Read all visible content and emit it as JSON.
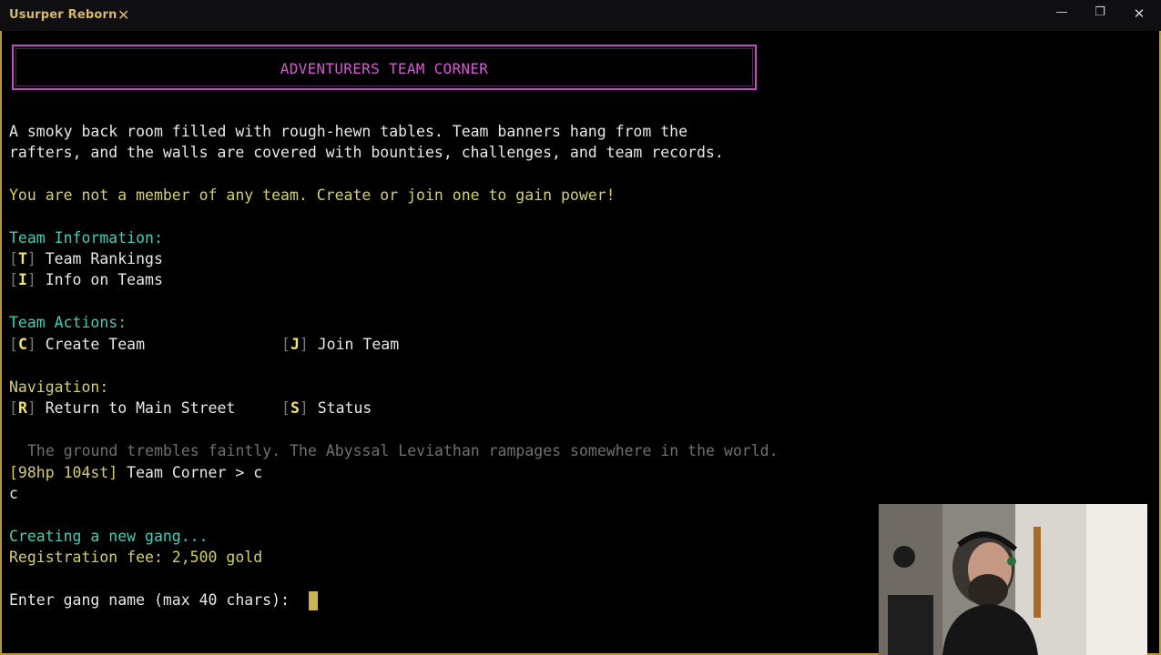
{
  "window": {
    "tab_title": "Usurper Reborn",
    "close_tab_glyph": "✕",
    "minimize_glyph": "—",
    "restore_glyph": "❐",
    "close_glyph": "✕"
  },
  "banner": {
    "title": "ADVENTURERS TEAM CORNER"
  },
  "description": {
    "line1": "A smoky back room filled with rough-hewn tables. Team banners hang from the",
    "line2": "rafters, and the walls are covered with bounties, challenges, and team records."
  },
  "notice": "You are not a member of any team. Create or join one to gain power!",
  "menu": {
    "team_information": {
      "header": "Team Information:",
      "items": [
        {
          "key": "T",
          "label": "Team Rankings"
        },
        {
          "key": "I",
          "label": "Info on Teams"
        }
      ]
    },
    "team_actions": {
      "header": "Team Actions:",
      "items": [
        {
          "key": "C",
          "label": "Create Team"
        },
        {
          "key": "J",
          "label": "Join Team"
        }
      ]
    },
    "navigation": {
      "header": "Navigation:",
      "items": [
        {
          "key": "R",
          "label": "Return to Main Street"
        },
        {
          "key": "S",
          "label": "Status"
        }
      ]
    }
  },
  "event_message": "The ground trembles faintly. The Abyssal Leviathan rampages somewhere in the world.",
  "prompt": {
    "stats": "[98hp 104st]",
    "location": "Team Corner > c",
    "echo": "c"
  },
  "creation": {
    "status": "Creating a new gang...",
    "fee": "Registration fee: 2,500 gold",
    "input_prompt": "Enter gang name (max 40 chars): "
  },
  "colors": {
    "banner_border": "#c34cc1",
    "banner_text": "#d35ad1",
    "yellow_text": "#d4cf6b",
    "cyan_text": "#3fcfb5",
    "tab_accent": "#d8b76a",
    "frame": "#b8982a"
  }
}
